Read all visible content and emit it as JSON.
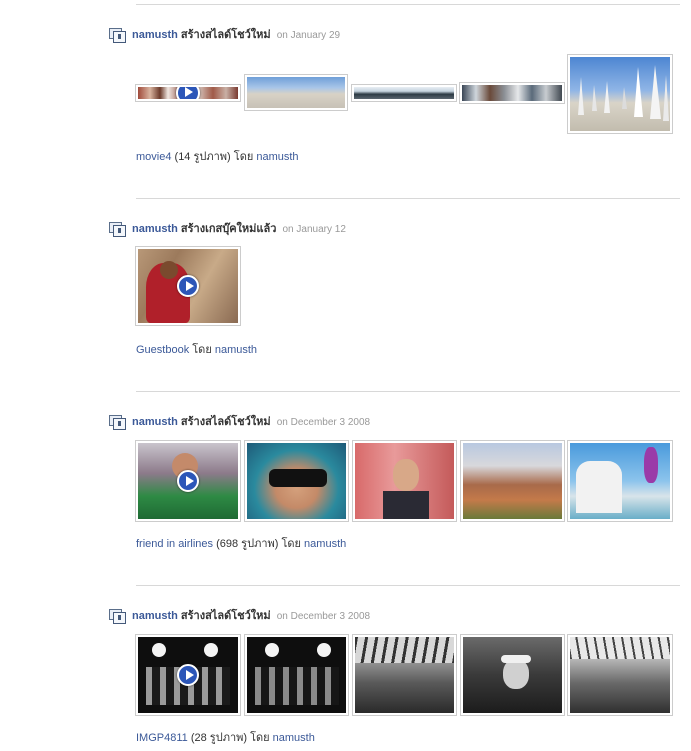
{
  "entries": [
    {
      "user": "namusth",
      "action": "สร้างสไลด์โชว์ใหม่",
      "date": "on January 29",
      "caption": {
        "link": "movie4",
        "count": "(14 รูปภาพ)",
        "by": "โดย",
        "user": "namusth"
      }
    },
    {
      "user": "namusth",
      "action": "สร้างเกสบุ๊คใหม่แล้ว",
      "date": "on January 12",
      "caption": {
        "link": "Guestbook",
        "count": "",
        "by": "โดย",
        "user": "namusth"
      }
    },
    {
      "user": "namusth",
      "action": "สร้างสไลด์โชว์ใหม่",
      "date": "on December 3 2008",
      "caption": {
        "link": "friend in airlines",
        "count": "(698 รูปภาพ)",
        "by": "โดย",
        "user": "namusth"
      }
    },
    {
      "user": "namusth",
      "action": "สร้างสไลด์โชว์ใหม่",
      "date": "on December 3 2008",
      "caption": {
        "link": "IMGP4811",
        "count": "(28 รูปภาพ)",
        "by": "โดย",
        "user": "namusth"
      }
    }
  ],
  "colors": {
    "link": "#3b5998",
    "date": "#999999",
    "separator": "#d8d8d8",
    "play_button": "#2c56b8"
  },
  "icons": {
    "entry_type": "slideshow-icon",
    "play": "play-icon"
  }
}
